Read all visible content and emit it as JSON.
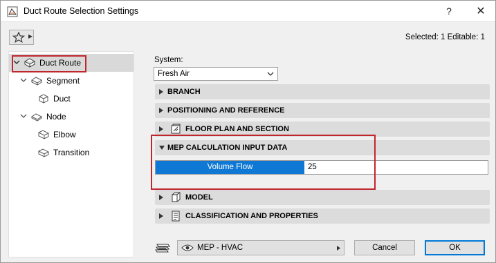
{
  "window": {
    "title": "Duct Route Selection Settings",
    "help_label": "?",
    "close_label": "✕"
  },
  "header": {
    "selected_info": "Selected: 1 Editable: 1"
  },
  "tree": {
    "items": [
      {
        "label": "Duct Route",
        "icon": "duct-route-icon",
        "expanded": true,
        "selected": true
      },
      {
        "label": "Segment",
        "icon": "segment-icon",
        "expanded": true
      },
      {
        "label": "Duct",
        "icon": "duct-icon"
      },
      {
        "label": "Node",
        "icon": "node-icon",
        "expanded": true
      },
      {
        "label": "Elbow",
        "icon": "elbow-icon"
      },
      {
        "label": "Transition",
        "icon": "transition-icon"
      }
    ]
  },
  "panel": {
    "system_label": "System:",
    "system_value": "Fresh Air",
    "sections": [
      {
        "title": "BRANCH",
        "expanded": false
      },
      {
        "title": "POSITIONING AND REFERENCE",
        "expanded": false
      },
      {
        "title": "FLOOR PLAN AND SECTION",
        "expanded": false,
        "icon": "floor-plan-icon"
      },
      {
        "title": "MEP CALCULATION INPUT DATA",
        "expanded": true
      },
      {
        "title": "MODEL",
        "expanded": false,
        "icon": "model-icon"
      },
      {
        "title": "CLASSIFICATION AND PROPERTIES",
        "expanded": false,
        "icon": "classification-icon"
      }
    ],
    "volume_flow_label": "Volume Flow",
    "volume_flow_value": "25"
  },
  "footer": {
    "view_label": "MEP - HVAC",
    "cancel_label": "Cancel",
    "ok_label": "OK"
  },
  "colors": {
    "highlight": "#c0272d",
    "selection_blue": "#0f78d4",
    "section_bg": "#dcdcdc"
  }
}
